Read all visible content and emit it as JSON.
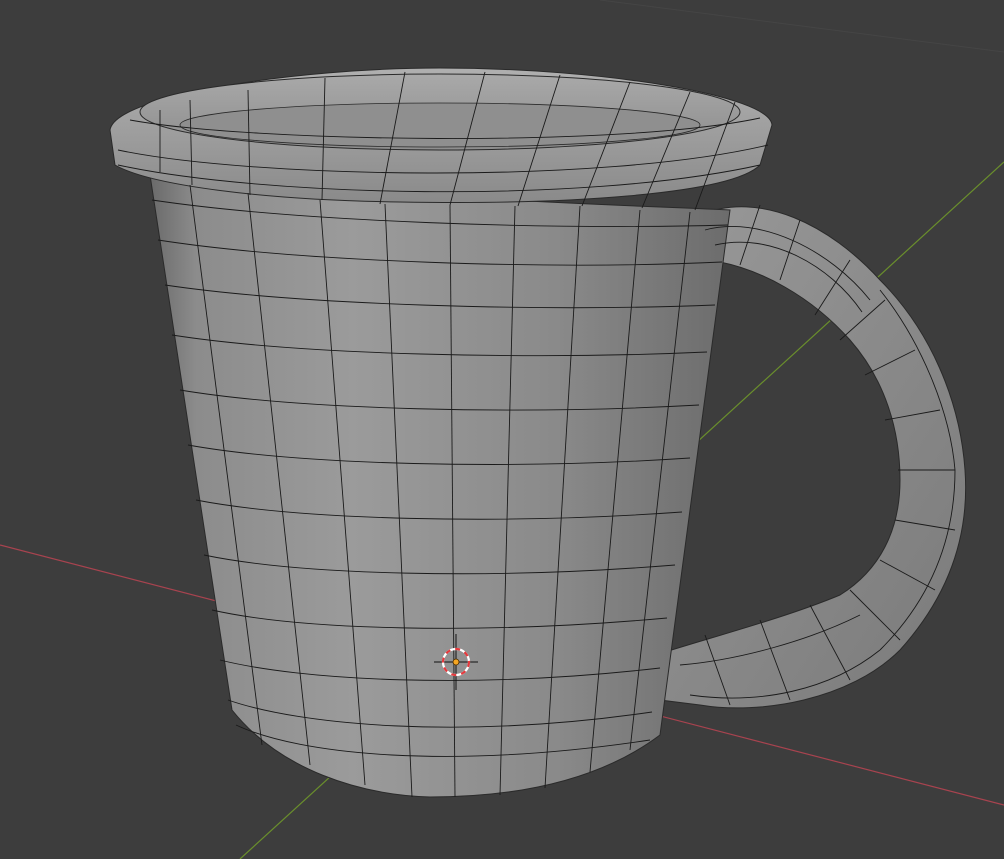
{
  "viewport": {
    "background_color": "#3d3d3d",
    "grid_line_color": "#444444",
    "x_axis_color": "#a8434f",
    "y_axis_color": "#6a8f2c"
  },
  "scene": {
    "object": "mug-mesh",
    "mesh_fill_color": "#8e8e8e",
    "wireframe_color": "#111111",
    "shading": "solid",
    "wireframe_overlay": true
  },
  "cursor": {
    "icon": "3d-cursor-icon",
    "ring_color_1": "#e5393d",
    "ring_color_2": "#ffffff",
    "origin_color": "#f5a623"
  }
}
